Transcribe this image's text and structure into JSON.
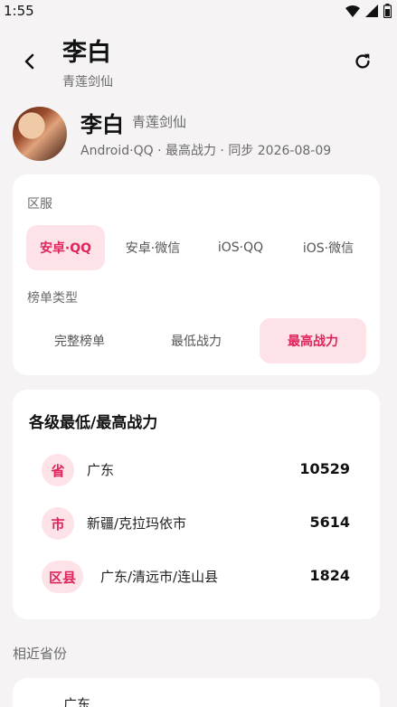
{
  "status_bar": {
    "time": "1:55"
  },
  "header": {
    "title": "李白",
    "subtitle": "青莲剑仙"
  },
  "profile": {
    "name": "李白",
    "title": "青莲剑仙",
    "meta": "Android·QQ · 最高战力 · 同步 2026-08-09"
  },
  "filters": {
    "server_label": "区服",
    "servers": [
      "安卓·QQ",
      "安卓·微信",
      "iOS·QQ",
      "iOS·微信"
    ],
    "selected_server": "安卓·QQ",
    "rank_type_label": "榜单类型",
    "rank_types": [
      "完整榜单",
      "最低战力",
      "最高战力"
    ],
    "selected_rank_type": "最高战力"
  },
  "power": {
    "title": "各级最低/最高战力",
    "rows": [
      {
        "level": "省",
        "region": "广东",
        "value": "10529"
      },
      {
        "level": "市",
        "region": "新疆/克拉玛依市",
        "value": "5614"
      },
      {
        "level": "区县",
        "region": "广东/清远市/连山县",
        "value": "1824"
      }
    ]
  },
  "nearby": {
    "label": "相近省份",
    "items": [
      "广东"
    ]
  },
  "colors": {
    "accent": "#e0245e",
    "accent_bg": "#fde3e8",
    "background": "#f5f3f4"
  }
}
